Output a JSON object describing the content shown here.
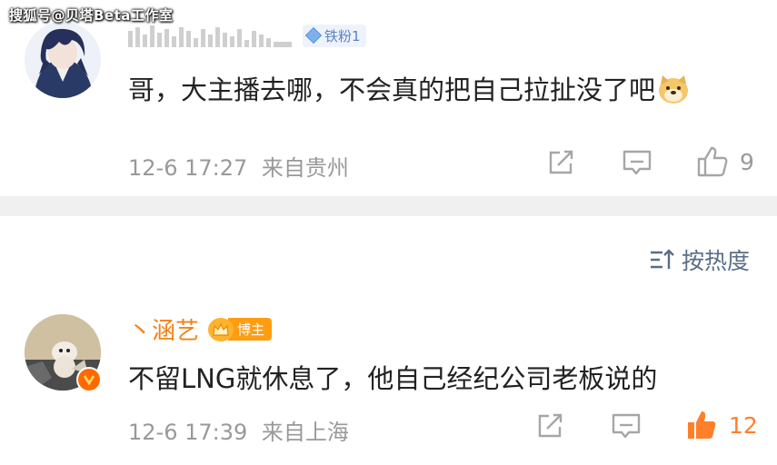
{
  "watermark": "搜狐号@贝塔Beta工作室",
  "comments": [
    {
      "badge": "铁粉1",
      "text": "哥，大主播去哪，不会真的把自己拉扯没了吧",
      "emoji": "doge-emoji",
      "time": "12-6 17:27",
      "location": "来自贵州",
      "likes": "9",
      "liked": false
    },
    {
      "name": "丶涵艺",
      "badge": "博主",
      "text": "不留LNG就休息了，他自己经纪公司老板说的",
      "time": "12-6 17:39",
      "location": "来自上海",
      "likes": "12",
      "liked": true
    }
  ],
  "sort": {
    "label": "按热度",
    "icon": "sort-icon"
  },
  "colors": {
    "accent_orange": "#f08318",
    "like_active": "#ff7f2a",
    "meta_gray": "#999999",
    "divider": "#f0f0f0",
    "sort_blue": "#5a6d87"
  }
}
